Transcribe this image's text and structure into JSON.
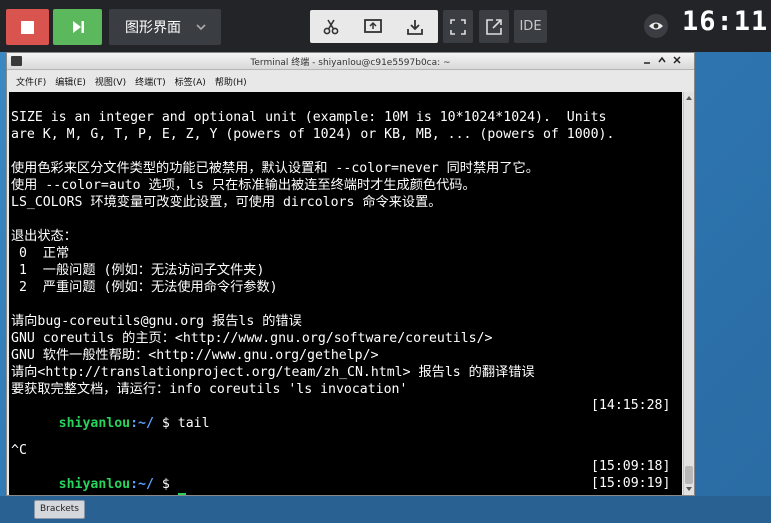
{
  "toolbar": {
    "mode_label": "图形界面",
    "ide_label": "IDE",
    "clock": "16:11",
    "icons": [
      "stop-icon",
      "run-icon",
      "chevron-down-icon",
      "scissors-icon",
      "switch-screen-icon",
      "download-icon",
      "fullscreen-icon",
      "external-link-icon",
      "eye-icon"
    ],
    "colors": {
      "stop": "#d9534f",
      "run": "#5cb85c"
    }
  },
  "window": {
    "title": "Terminal 终端 - shiyanlou@c91e5597b0ca: ~",
    "menu": [
      "文件(F)",
      "编辑(E)",
      "视图(V)",
      "终端(T)",
      "标签(A)",
      "帮助(H)"
    ]
  },
  "terminal": {
    "lines": [
      "",
      "SIZE is an integer and optional unit (example: 10M is 10*1024*1024).  Units",
      "are K, M, G, T, P, E, Z, Y (powers of 1024) or KB, MB, ... (powers of 1000).",
      "",
      "使用色彩来区分文件类型的功能已被禁用，默认设置和 --color=never 同时禁用了它。",
      "使用 --color=auto 选项，ls 只在标准输出被连至终端时才生成颜色代码。",
      "LS_COLORS 环境变量可改变此设置，可使用 dircolors 命令来设置。",
      "",
      "退出状态：",
      " 0  正常",
      " 1  一般问题 (例如：无法访问子文件夹)",
      " 2  严重问题 (例如：无法使用命令行参数)",
      "",
      "请向bug-coreutils@gnu.org 报告ls 的错误",
      "GNU coreutils 的主页：<http://www.gnu.org/software/coreutils/>",
      "GNU 软件一般性帮助：<http://www.gnu.org/gethelp/>",
      "请向<http://translationproject.org/team/zh_CN.html> 报告ls 的翻译错误",
      "要获取完整文档，请运行：info coreutils 'ls invocation'"
    ],
    "prompt_user": "shiyanlou",
    "prompt_path": ":~/",
    "prompt_symbol": "$",
    "commands": [
      {
        "cmd": " tail",
        "time": "[14:15:28]"
      },
      {
        "cmd": "",
        "time": "[15:09:18]"
      },
      {
        "cmd": "",
        "time": "[15:09:19]"
      }
    ],
    "interrupt": "^C",
    "colors": {
      "user": "#27d35b",
      "path": "#5aa0ff",
      "background": "#000000"
    }
  },
  "taskbar": {
    "items": [
      "Brackets"
    ]
  }
}
